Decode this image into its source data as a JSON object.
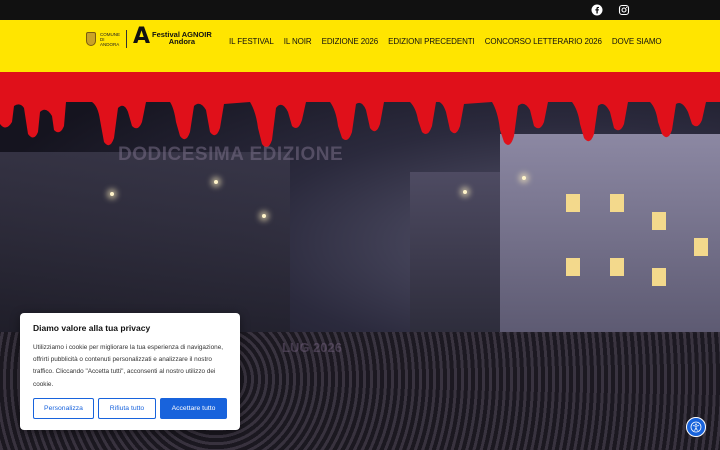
{
  "topbar": {
    "social": [
      {
        "name": "facebook-icon"
      },
      {
        "name": "instagram-icon"
      }
    ]
  },
  "header": {
    "comune_text": "Comune di Andora",
    "logo_letter": "A",
    "logo_line1": "Festival AGNOIR",
    "logo_line2": "Andora",
    "nav": [
      {
        "label": "IL FESTIVAL"
      },
      {
        "label": "IL NOIR"
      },
      {
        "label": "EDIZIONE 2026"
      },
      {
        "label": "EDIZIONI PRECEDENTI"
      },
      {
        "label": "CONCORSO LETTERARIO 2026"
      },
      {
        "label": "DOVE SIAMO"
      }
    ]
  },
  "hero": {
    "title": "DODICESIMA EDIZIONE",
    "subtitle": "LUG 2026",
    "accent_color": "#e0101a"
  },
  "cookie": {
    "title": "Diamo valore alla tua privacy",
    "text": "Utilizziamo i cookie per migliorare la tua esperienza di navigazione, offrirti pubblicità o contenuti personalizzati e analizzare il nostro traffico. Cliccando \"Accetta tutti\", acconsenti al nostro utilizzo dei cookie.",
    "customize_label": "Personalizza",
    "reject_label": "Rifiuta tutto",
    "accept_label": "Accettare tutto",
    "button_color": "#1863dc"
  },
  "accessibility": {
    "icon": "accessibility-icon"
  }
}
